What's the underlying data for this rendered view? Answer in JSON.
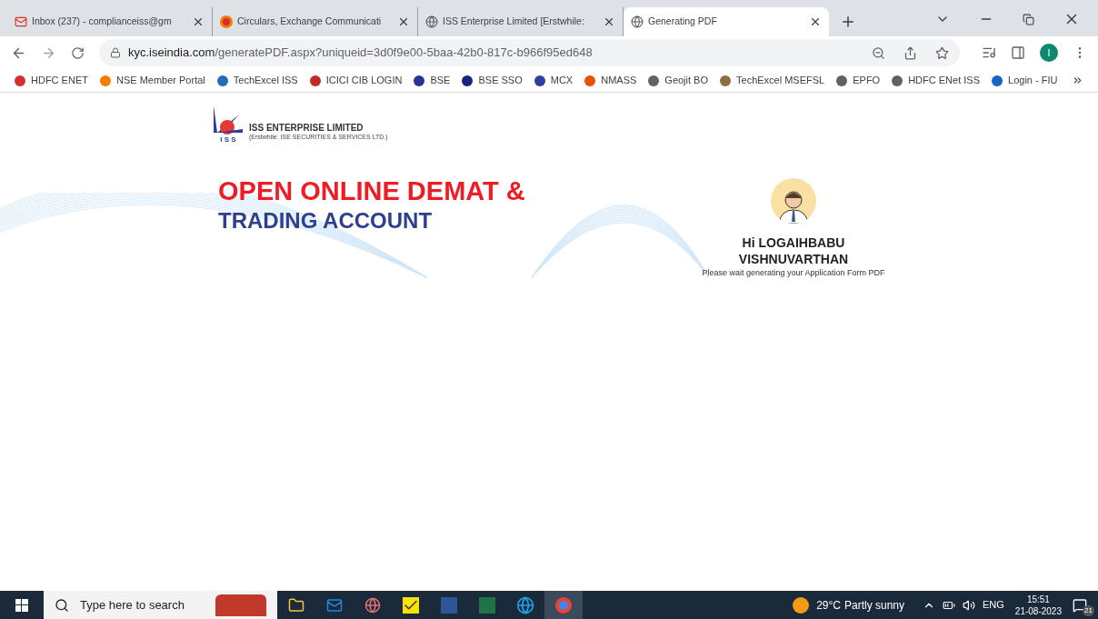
{
  "tabs": [
    {
      "label": "Inbox (237) - complianceiss@gm",
      "kind": "mail",
      "selected": false
    },
    {
      "label": "Circulars, Exchange Communicati",
      "kind": "site",
      "selected": false
    },
    {
      "label": "ISS Enterprise Limited [Erstwhile:",
      "kind": "globe",
      "selected": false
    },
    {
      "label": "Generating PDF",
      "kind": "globe",
      "selected": true
    }
  ],
  "address_bar": {
    "host": "kyc.iseindia.com",
    "path": "/generatePDF.aspx?uniqueid=3d0f9e00-5baa-42b0-817c-b966f95ed648"
  },
  "profile": {
    "initial": "I"
  },
  "bookmarks": [
    {
      "label": "HDFC ENET",
      "color": "#d32f2f"
    },
    {
      "label": "NSE Member Portal",
      "color": "#f57c00"
    },
    {
      "label": "TechExcel ISS",
      "color": "#1e6fb5"
    },
    {
      "label": "ICICI CIB LOGIN",
      "color": "#c62828"
    },
    {
      "label": "BSE",
      "color": "#283593"
    },
    {
      "label": "BSE SSO",
      "color": "#1a237e"
    },
    {
      "label": "MCX",
      "color": "#303f9f"
    },
    {
      "label": "NMASS",
      "color": "#e65100"
    },
    {
      "label": "Geojit BO",
      "color": "#5f6368"
    },
    {
      "label": "TechExcel MSEFSL",
      "color": "#8d6e3f"
    },
    {
      "label": "EPFO",
      "color": "#5f6368"
    },
    {
      "label": "HDFC ENet ISS",
      "color": "#5f6368"
    },
    {
      "label": "Login - FIU",
      "color": "#1565c0"
    }
  ],
  "page": {
    "company": "ISS ENTERPRISE LIMITED",
    "company_note": "(Erstwhile: ISE SECURITIES & SERVICES LTD.)",
    "logo_letters": "I S S",
    "headline_1": "OPEN ONLINE DEMAT &",
    "headline_2": "TRADING ACCOUNT",
    "greeting_1": "Hi LOGAIHBABU",
    "greeting_2": "VISHNUVARTHAN",
    "message": "Please wait generating your Application Form PDF"
  },
  "taskbar": {
    "search_placeholder": "Type here to search",
    "temperature": "29°C",
    "weather": "Partly sunny",
    "language": "ENG",
    "time": "15:51",
    "date": "21-08-2023",
    "notifications": "21"
  }
}
